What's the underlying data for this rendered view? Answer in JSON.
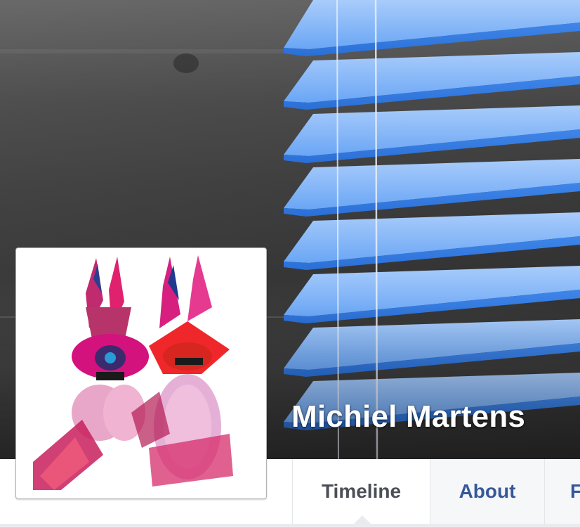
{
  "profile": {
    "name": "Michiel Martens"
  },
  "tabs": [
    {
      "label": "Timeline",
      "active": true
    },
    {
      "label": "About",
      "active": false
    },
    {
      "label": "F",
      "active": false
    }
  ],
  "colors": {
    "link_blue": "#365899",
    "active_tab_text": "#4b4f56",
    "blind_blue": "#5a9bf0",
    "page_bg": "#e9ebee"
  },
  "icons": {
    "active_tab_indicator": "caret-up-icon"
  }
}
